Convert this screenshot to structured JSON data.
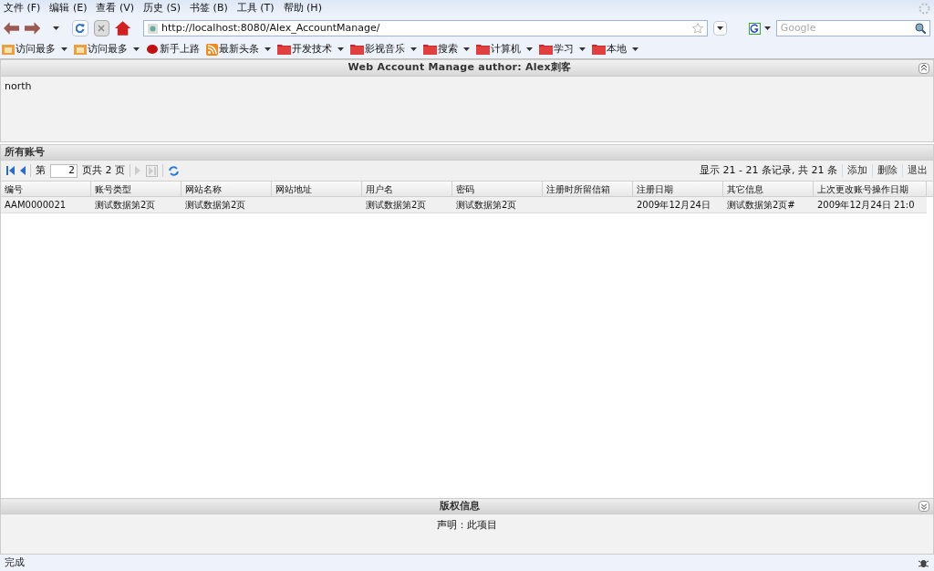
{
  "menu": [
    "文件 (F)",
    "编辑 (E)",
    "查看 (V)",
    "历史 (S)",
    "书签 (B)",
    "工具 (T)",
    "帮助 (H)"
  ],
  "address": {
    "value": "http://localhost:8080/Alex_AccountManage/"
  },
  "search": {
    "placeholder": "Google"
  },
  "bookmarks": [
    {
      "label": "访问最多",
      "kind": "smart",
      "dropdown": true
    },
    {
      "label": "访问最多",
      "kind": "smart",
      "dropdown": true
    },
    {
      "label": "新手上路",
      "kind": "page",
      "dropdown": false
    },
    {
      "label": "最新头条",
      "kind": "feed",
      "dropdown": true
    },
    {
      "label": "开发技术",
      "kind": "folder",
      "dropdown": true
    },
    {
      "label": "影视音乐",
      "kind": "folder",
      "dropdown": true
    },
    {
      "label": "搜索",
      "kind": "folder",
      "dropdown": true
    },
    {
      "label": "计算机",
      "kind": "folder",
      "dropdown": true
    },
    {
      "label": "学习",
      "kind": "folder",
      "dropdown": true
    },
    {
      "label": "本地",
      "kind": "folder",
      "dropdown": true
    }
  ],
  "north": {
    "title": "Web Account Manage author: Alex刺客",
    "body": "north"
  },
  "grid": {
    "title": "所有账号",
    "page_prefix": "第",
    "page": "2",
    "page_suffix": "页共 2 页",
    "summary": "显示 21 - 21 条记录, 共 21 条",
    "actions": [
      "添加",
      "删除",
      "退出"
    ],
    "columns": [
      "编号",
      "账号类型",
      "网站名称",
      "网站地址",
      "用户名",
      "密码",
      "注册时所留信箱",
      "注册日期",
      "其它信息",
      "上次更改账号操作日期"
    ],
    "rows": [
      [
        "AAM0000021",
        "测试数据第2页",
        "测试数据第2页",
        "",
        "测试数据第2页",
        "测试数据第2页",
        "",
        "2009年12月24日",
        "测试数据第2页#",
        "2009年12月24日 21:0"
      ]
    ]
  },
  "south": {
    "title": "版权信息",
    "body": "声明：此项目"
  },
  "status_bar": "完成"
}
